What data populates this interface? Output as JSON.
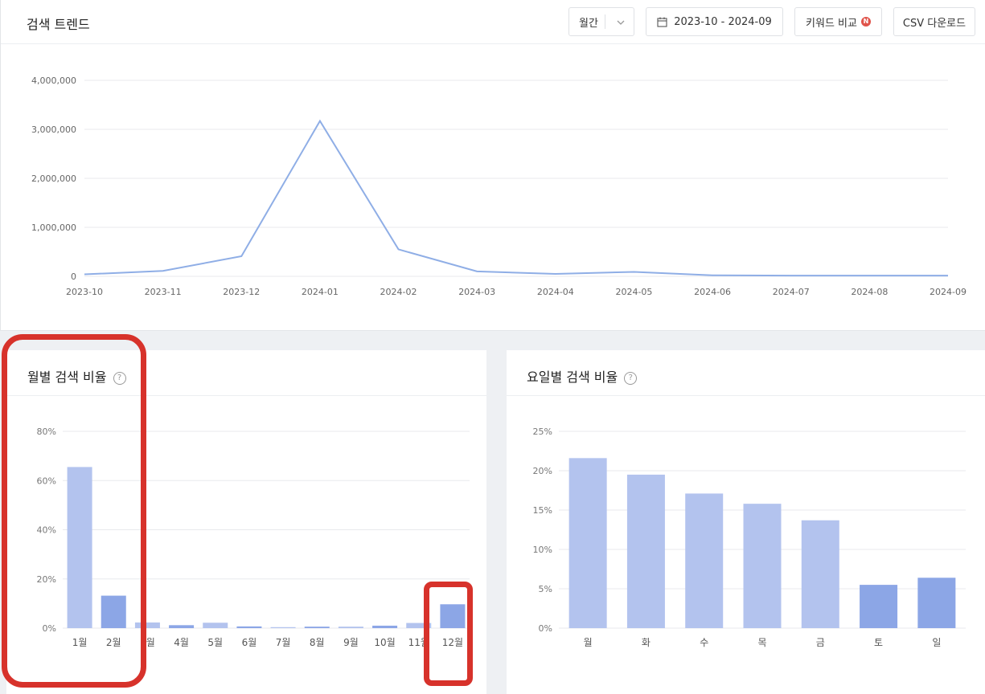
{
  "trend": {
    "title": "검색 트렌드",
    "period_label": "월간",
    "date_range": "2023-10 - 2024-09",
    "compare_label": "키워드 비교",
    "new_badge": "N",
    "csv_label": "CSV 다운로드"
  },
  "monthly": {
    "title": "월별 검색 비율",
    "help": "?"
  },
  "weekday": {
    "title": "요일별 검색 비율",
    "help": "?"
  },
  "colors": {
    "line": "#8faee6",
    "bar_light": "#b3c3ee",
    "bar_dark": "#8ca6e6",
    "grid": "#e8eaed",
    "highlight": "#d7322b"
  },
  "chart_data": [
    {
      "type": "line",
      "x": [
        "2023-10",
        "2023-11",
        "2023-12",
        "2024-01",
        "2024-02",
        "2024-03",
        "2024-04",
        "2024-05",
        "2024-06",
        "2024-07",
        "2024-08",
        "2024-09"
      ],
      "series": [
        {
          "values": [
            40000,
            110000,
            410000,
            3170000,
            550000,
            100000,
            50000,
            90000,
            20000,
            15000,
            15000,
            15000
          ]
        }
      ],
      "ylim": [
        0,
        4000000
      ],
      "yticks": [
        "0",
        "1,000,000",
        "2,000,000",
        "3,000,000",
        "4,000,000"
      ],
      "grid": true
    },
    {
      "type": "bar",
      "categories": [
        "1월",
        "2월",
        "3월",
        "4월",
        "5월",
        "6월",
        "7월",
        "8월",
        "9월",
        "10월",
        "11월",
        "12월"
      ],
      "values": [
        65.5,
        13.2,
        2.3,
        1.2,
        2.2,
        0.7,
        0.4,
        0.6,
        0.6,
        1.0,
        2.1,
        9.7
      ],
      "shade": [
        "light",
        "dark",
        "light",
        "dark",
        "light",
        "dark",
        "light",
        "dark",
        "light",
        "dark",
        "light",
        "dark"
      ],
      "ylim": [
        0,
        80
      ],
      "yticks": [
        "0%",
        "20%",
        "40%",
        "60%",
        "80%"
      ],
      "grid": true
    },
    {
      "type": "bar",
      "categories": [
        "월",
        "화",
        "수",
        "목",
        "금",
        "토",
        "일"
      ],
      "values": [
        21.6,
        19.5,
        17.1,
        15.8,
        13.7,
        5.5,
        6.4
      ],
      "shade": [
        "light",
        "light",
        "light",
        "light",
        "light",
        "dark",
        "dark"
      ],
      "ylim": [
        0,
        25
      ],
      "yticks": [
        "0%",
        "5%",
        "10%",
        "15%",
        "20%",
        "25%"
      ],
      "grid": true
    }
  ]
}
